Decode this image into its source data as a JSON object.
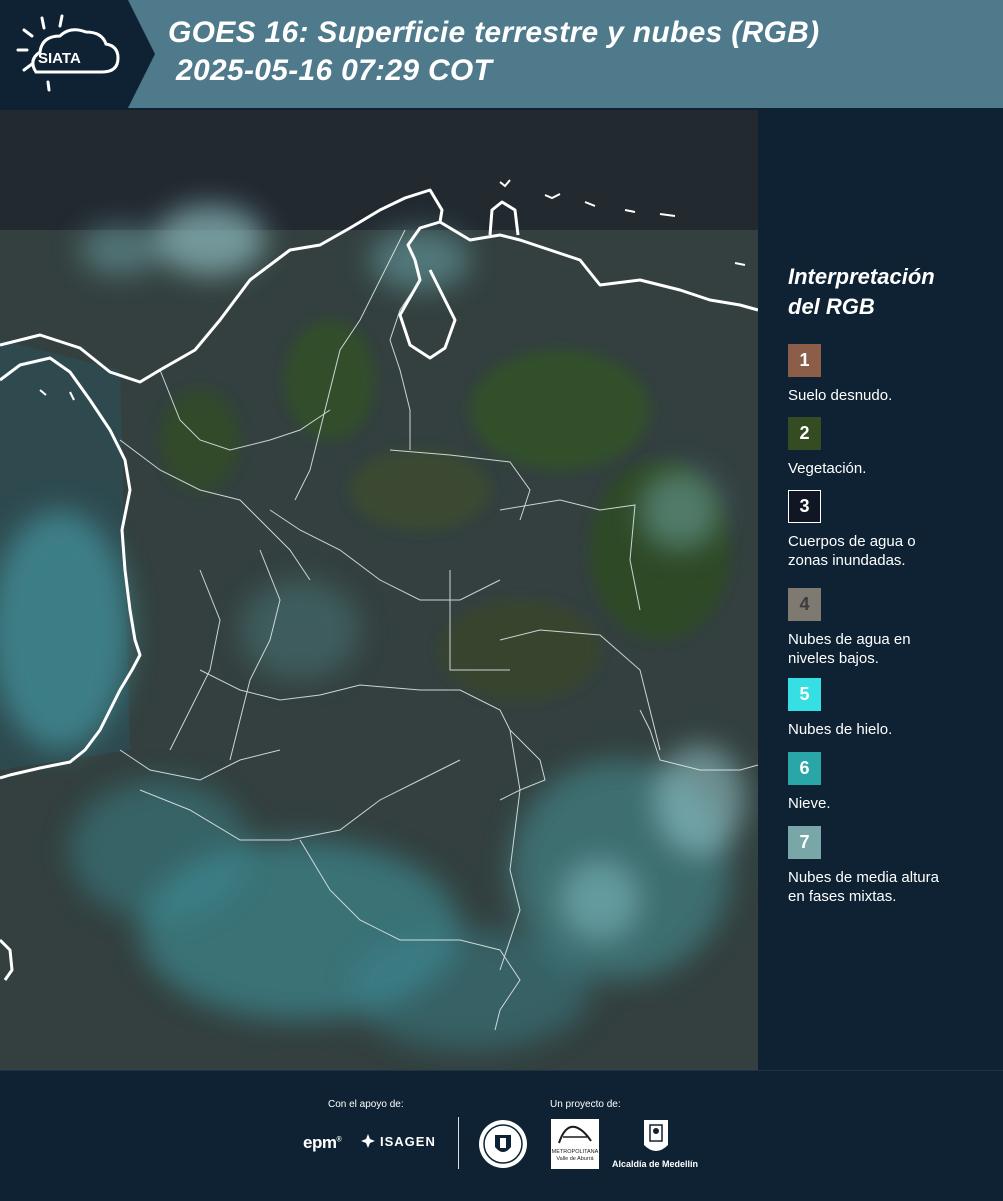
{
  "header": {
    "logo_text": "SIATA",
    "title_line1": "GOES 16: Superficie terrestre y nubes (RGB)",
    "title_line2": "2025-05-16 07:29 COT",
    "header_color": "#4f7a8c",
    "logo_bg_color": "#0e2233"
  },
  "legend": {
    "title_line1": "Interpretación",
    "title_line2": "del RGB",
    "items": [
      {
        "number": "1",
        "label_lines": [
          "Suelo desnudo."
        ],
        "color": "#8c5e4a"
      },
      {
        "number": "2",
        "label_lines": [
          "Vegetación."
        ],
        "color": "#354c23"
      },
      {
        "number": "3",
        "label_lines": [
          "Cuerpos de agua o",
          "zonas inundadas."
        ],
        "color": "#101623"
      },
      {
        "number": "4",
        "label_lines": [
          "Nubes de agua en",
          "niveles bajos."
        ],
        "color": "#7e7a72"
      },
      {
        "number": "5",
        "label_lines": [
          "Nubes de hielo."
        ],
        "color": "#36dfe3"
      },
      {
        "number": "6",
        "label_lines": [
          "Nieve."
        ],
        "color": "#28a6a8"
      },
      {
        "number": "7",
        "label_lines": [
          "Nubes de media altura",
          "en fases mixtas."
        ],
        "color": "#79a7a8"
      }
    ]
  },
  "footer": {
    "support_label": "Con el apoyo de:",
    "project_label": "Un proyecto de:",
    "sponsors": [
      "epm",
      "ISAGEN"
    ],
    "partners": [
      "Área Metropolitana Valle de Aburrá",
      "Alcaldía de Medellín"
    ],
    "area_logo_text_line1": "METROPOLITANA",
    "area_logo_text_line2": "Valle de Aburrá",
    "alcaldia_label": "Alcaldía de Medellín"
  }
}
